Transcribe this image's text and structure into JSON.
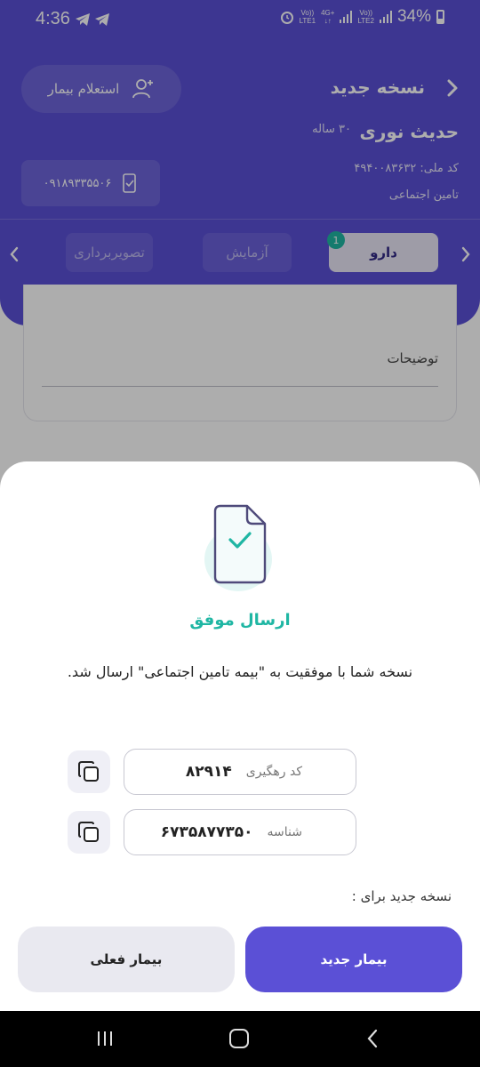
{
  "status_bar": {
    "time": "4:36",
    "sim1_top": "Vo))",
    "sim1_bottom": "LTE1",
    "net_top": "4G+",
    "net_bottom": "↓↑",
    "sim2_top": "Vo))",
    "sim2_bottom": "LTE2",
    "battery": "34%"
  },
  "header": {
    "title": "نسخه جدید",
    "inquiry_button": "استعلام بیمار",
    "patient_name": "حدیث نوری",
    "patient_age": "۳۰ ساله",
    "national_id": "کد ملی: ۴۹۴۰۰۸۳۶۳۲",
    "insurance": "تامین اجتماعی",
    "phone": "۰۹۱۸۹۳۳۵۵۰۶"
  },
  "tabs": {
    "items": [
      "دارو",
      "آزمایش",
      "تصویربرداری"
    ],
    "badge": "1"
  },
  "form": {
    "description_label": "توضیحات"
  },
  "sheet": {
    "title": "ارسال موفق",
    "message": "نسخه شما با موفقیت به \"بیمه تامین اجتماعی\" ارسال شد.",
    "tracking_label": "کد رهگیری",
    "tracking_value": "۸۲۹۱۴",
    "id_label": "شناسه",
    "id_value": "۶۷۳۵۸۷۷۳۵۰",
    "new_for": "نسخه جدید برای :",
    "new_patient": "بیمار جدید",
    "current_patient": "بیمار فعلی"
  },
  "colors": {
    "primary": "#5b50d6",
    "success": "#1fb6a3"
  }
}
